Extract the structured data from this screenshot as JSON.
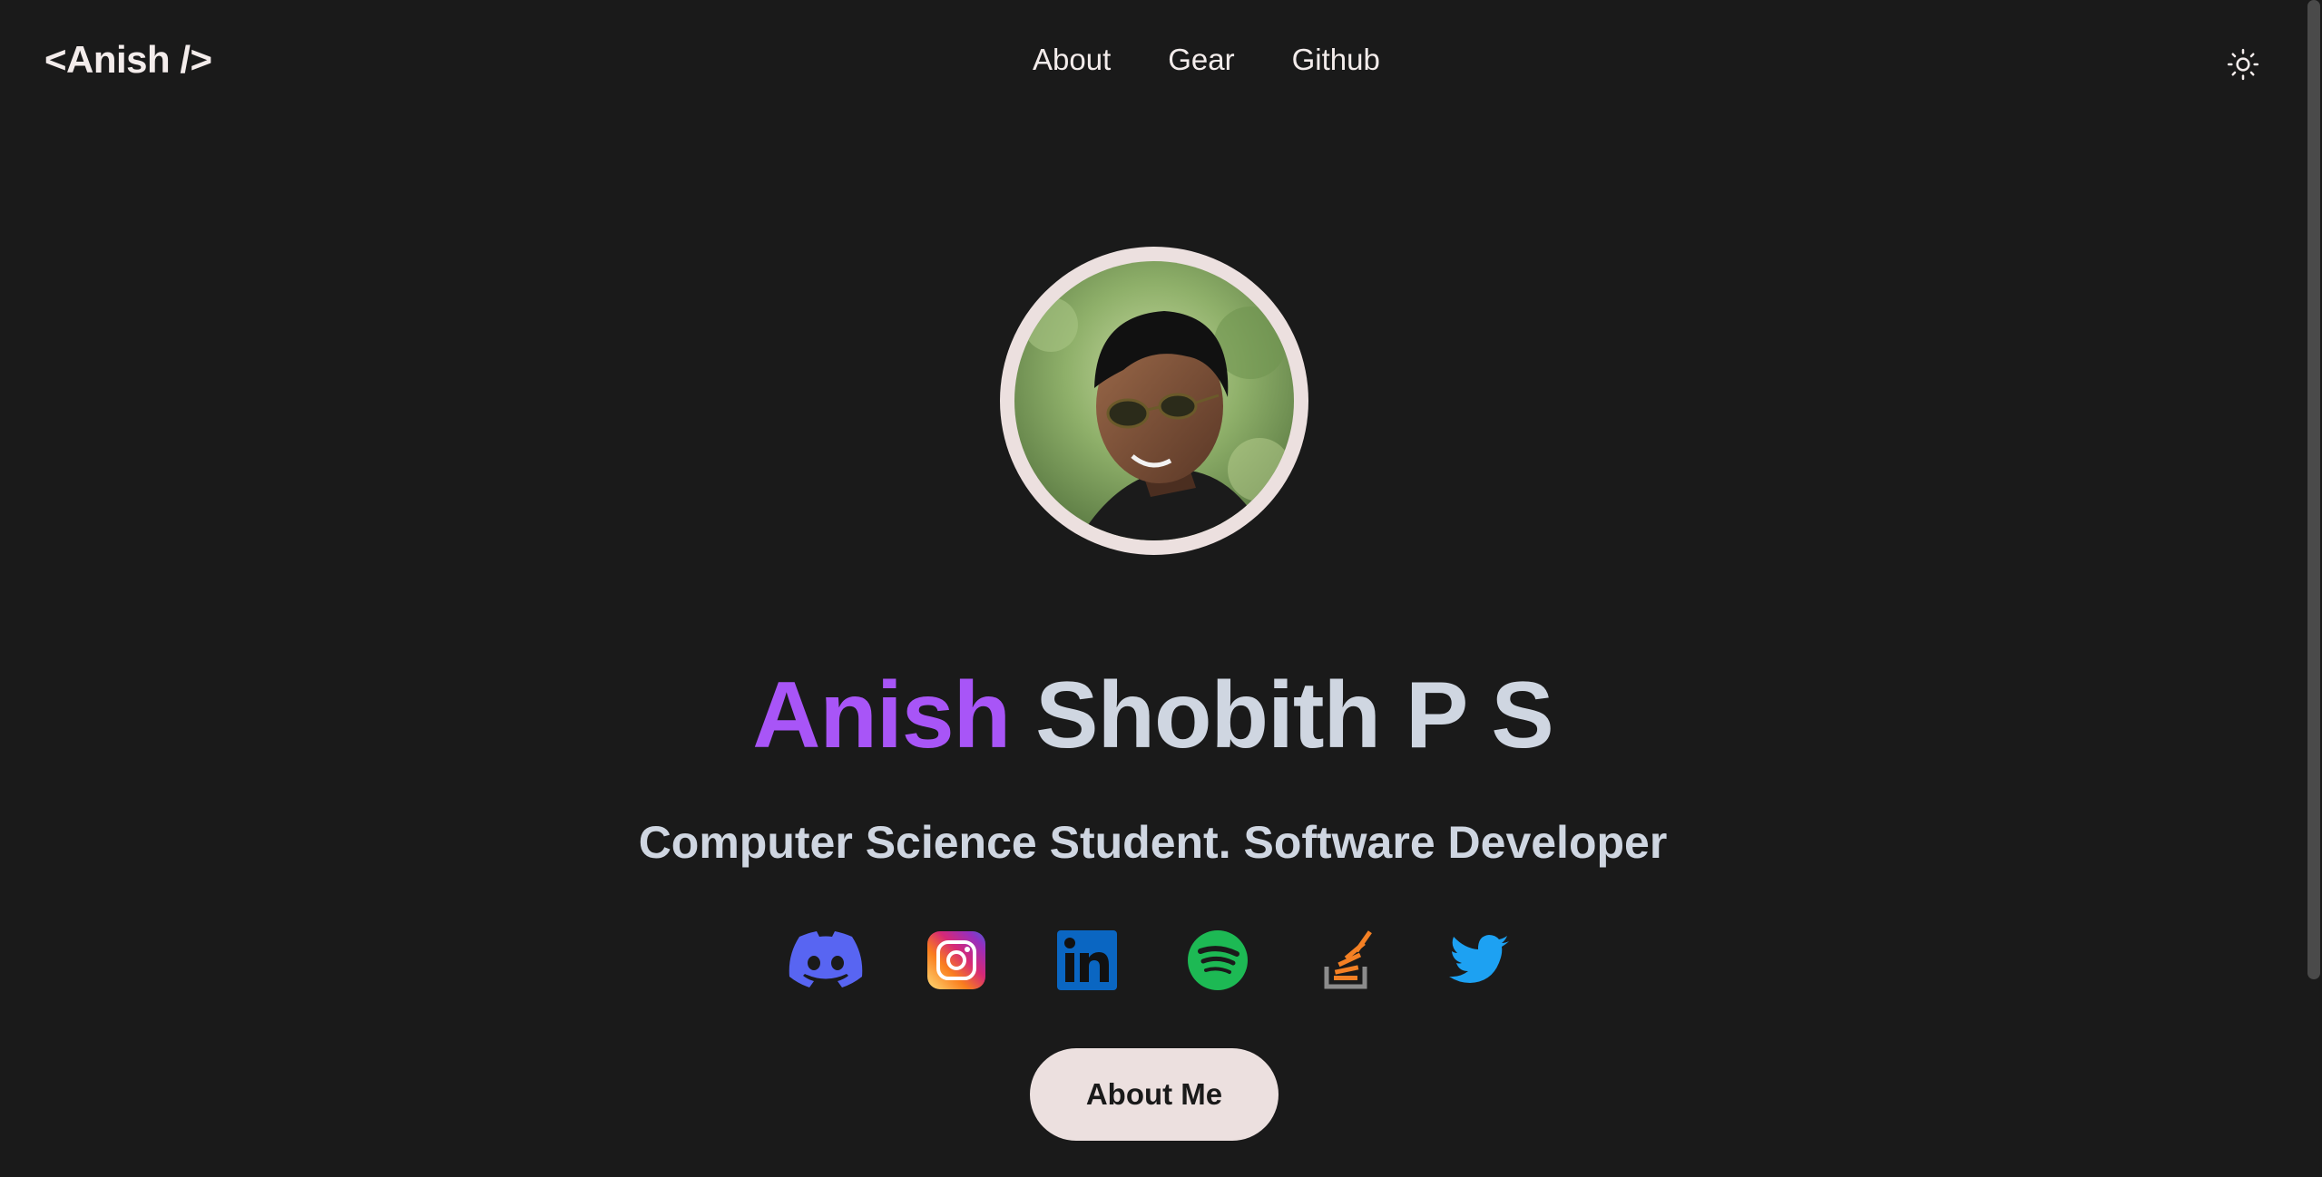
{
  "header": {
    "logo": "<Anish />",
    "nav": [
      {
        "label": "About"
      },
      {
        "label": "Gear"
      },
      {
        "label": "Github"
      }
    ],
    "theme_toggle_icon": "sun-icon"
  },
  "hero": {
    "avatar_icon": "profile-photo",
    "name_first": "Anish",
    "name_rest": "Shobith P S",
    "tagline": "Computer Science Student. Software Developer",
    "socials": [
      {
        "icon": "discord-icon",
        "color": "#5865f2"
      },
      {
        "icon": "instagram-icon",
        "color": "#e1306c"
      },
      {
        "icon": "linkedin-icon",
        "color": "#0a66c2"
      },
      {
        "icon": "spotify-icon",
        "color": "#1db954"
      },
      {
        "icon": "stackoverflow-icon",
        "color": "#f48024"
      },
      {
        "icon": "twitter-icon",
        "color": "#1da1f2"
      }
    ],
    "cta_label": "About Me"
  },
  "colors": {
    "background": "#1a1a1a",
    "accent": "#a855f7",
    "text": "#cfd6e1",
    "button_bg": "#ece0df"
  }
}
